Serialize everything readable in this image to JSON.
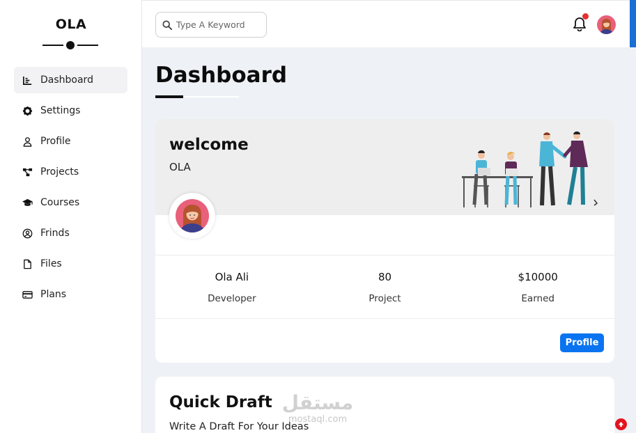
{
  "sidebar": {
    "logo": "OLA",
    "items": [
      {
        "label": "Dashboard",
        "icon": "chart-icon",
        "active": true
      },
      {
        "label": "Settings",
        "icon": "gear-icon"
      },
      {
        "label": "Profile",
        "icon": "user-icon"
      },
      {
        "label": "Projects",
        "icon": "diagram-icon"
      },
      {
        "label": "Courses",
        "icon": "graduation-cap-icon"
      },
      {
        "label": "Frinds",
        "icon": "user-circle-icon"
      },
      {
        "label": "Files",
        "icon": "file-icon"
      },
      {
        "label": "Plans",
        "icon": "credit-card-icon"
      }
    ]
  },
  "topbar": {
    "search_placeholder": "Type A Keyword",
    "notification_icon": "bell-icon",
    "has_unread": true
  },
  "page": {
    "title": "Dashboard"
  },
  "welcome_card": {
    "heading": "welcome",
    "name": "OLA",
    "stats": [
      {
        "value": "Ola Ali",
        "label": "Developer"
      },
      {
        "value": "80",
        "label": "Project"
      },
      {
        "value": "$10000",
        "label": "Earned"
      }
    ],
    "profile_button": "Profile"
  },
  "quick_draft": {
    "title": "Quick Draft",
    "subtitle": "Write A Draft For Your Ideas"
  },
  "watermark": {
    "arabic": "مستقل",
    "latin": "mostaql.com"
  },
  "colors": {
    "accent": "#0a74f0",
    "background": "#eef1f6",
    "notification": "#e33030"
  }
}
